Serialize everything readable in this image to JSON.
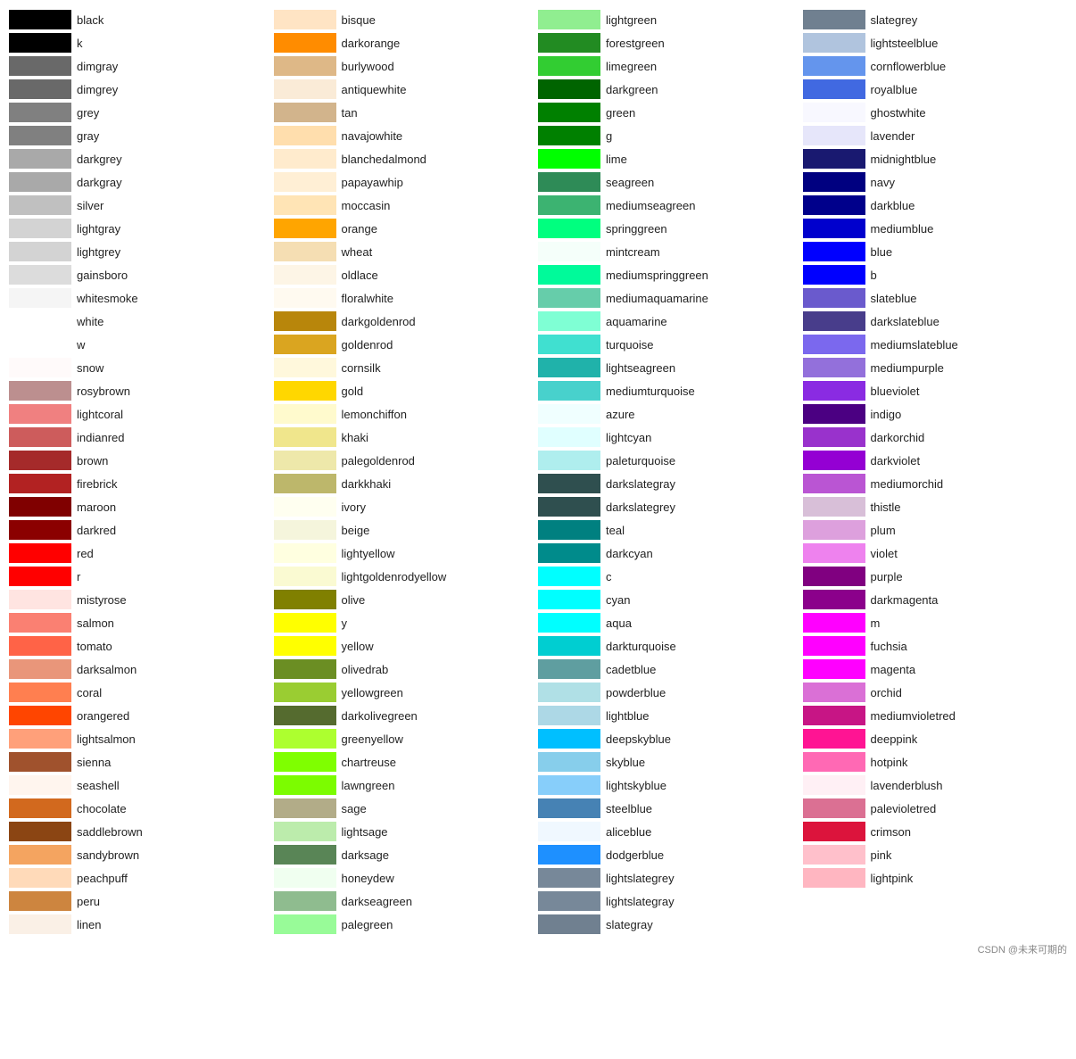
{
  "columns": [
    {
      "id": "col1",
      "items": [
        {
          "name": "black",
          "color": "#000000"
        },
        {
          "name": "k",
          "color": "#000000"
        },
        {
          "name": "dimgray",
          "color": "#696969"
        },
        {
          "name": "dimgrey",
          "color": "#696969"
        },
        {
          "name": "grey",
          "color": "#808080"
        },
        {
          "name": "gray",
          "color": "#808080"
        },
        {
          "name": "darkgrey",
          "color": "#a9a9a9"
        },
        {
          "name": "darkgray",
          "color": "#a9a9a9"
        },
        {
          "name": "silver",
          "color": "#c0c0c0"
        },
        {
          "name": "lightgray",
          "color": "#d3d3d3"
        },
        {
          "name": "lightgrey",
          "color": "#d3d3d3"
        },
        {
          "name": "gainsboro",
          "color": "#dcdcdc"
        },
        {
          "name": "whitesmoke",
          "color": "#f5f5f5"
        },
        {
          "name": "white",
          "color": "#ffffff"
        },
        {
          "name": "w",
          "color": "#ffffff"
        },
        {
          "name": "snow",
          "color": "#fffafa"
        },
        {
          "name": "rosybrown",
          "color": "#bc8f8f"
        },
        {
          "name": "lightcoral",
          "color": "#f08080"
        },
        {
          "name": "indianred",
          "color": "#cd5c5c"
        },
        {
          "name": "brown",
          "color": "#a52a2a"
        },
        {
          "name": "firebrick",
          "color": "#b22222"
        },
        {
          "name": "maroon",
          "color": "#800000"
        },
        {
          "name": "darkred",
          "color": "#8b0000"
        },
        {
          "name": "red",
          "color": "#ff0000"
        },
        {
          "name": "r",
          "color": "#ff0000"
        },
        {
          "name": "mistyrose",
          "color": "#ffe4e1"
        },
        {
          "name": "salmon",
          "color": "#fa8072"
        },
        {
          "name": "tomato",
          "color": "#ff6347"
        },
        {
          "name": "darksalmon",
          "color": "#e9967a"
        },
        {
          "name": "coral",
          "color": "#ff7f50"
        },
        {
          "name": "orangered",
          "color": "#ff4500"
        },
        {
          "name": "lightsalmon",
          "color": "#ffa07a"
        },
        {
          "name": "sienna",
          "color": "#a0522d"
        },
        {
          "name": "seashell",
          "color": "#fff5ee"
        },
        {
          "name": "chocolate",
          "color": "#d2691e"
        },
        {
          "name": "saddlebrown",
          "color": "#8b4513"
        },
        {
          "name": "sandybrown",
          "color": "#f4a460"
        },
        {
          "name": "peachpuff",
          "color": "#ffdab9"
        },
        {
          "name": "peru",
          "color": "#cd853f"
        },
        {
          "name": "linen",
          "color": "#faf0e6"
        }
      ]
    },
    {
      "id": "col2",
      "items": [
        {
          "name": "bisque",
          "color": "#ffe4c4"
        },
        {
          "name": "darkorange",
          "color": "#ff8c00"
        },
        {
          "name": "burlywood",
          "color": "#deb887"
        },
        {
          "name": "antiquewhite",
          "color": "#faebd7"
        },
        {
          "name": "tan",
          "color": "#d2b48c"
        },
        {
          "name": "navajowhite",
          "color": "#ffdead"
        },
        {
          "name": "blanchedalmond",
          "color": "#ffebcd"
        },
        {
          "name": "papayawhip",
          "color": "#ffefd5"
        },
        {
          "name": "moccasin",
          "color": "#ffe4b5"
        },
        {
          "name": "orange",
          "color": "#ffa500"
        },
        {
          "name": "wheat",
          "color": "#f5deb3"
        },
        {
          "name": "oldlace",
          "color": "#fdf5e6"
        },
        {
          "name": "floralwhite",
          "color": "#fffaf0"
        },
        {
          "name": "darkgoldenrod",
          "color": "#b8860b"
        },
        {
          "name": "goldenrod",
          "color": "#daa520"
        },
        {
          "name": "cornsilk",
          "color": "#fff8dc"
        },
        {
          "name": "gold",
          "color": "#ffd700"
        },
        {
          "name": "lemonchiffon",
          "color": "#fffacd"
        },
        {
          "name": "khaki",
          "color": "#f0e68c"
        },
        {
          "name": "palegoldenrod",
          "color": "#eee8aa"
        },
        {
          "name": "darkkhaki",
          "color": "#bdb76b"
        },
        {
          "name": "ivory",
          "color": "#fffff0"
        },
        {
          "name": "beige",
          "color": "#f5f5dc"
        },
        {
          "name": "lightyellow",
          "color": "#ffffe0"
        },
        {
          "name": "lightgoldenrodyellow",
          "color": "#fafad2"
        },
        {
          "name": "olive",
          "color": "#808000"
        },
        {
          "name": "y",
          "color": "#ffff00"
        },
        {
          "name": "yellow",
          "color": "#ffff00"
        },
        {
          "name": "olivedrab",
          "color": "#6b8e23"
        },
        {
          "name": "yellowgreen",
          "color": "#9acd32"
        },
        {
          "name": "darkolivegreen",
          "color": "#556b2f"
        },
        {
          "name": "greenyellow",
          "color": "#adff2f"
        },
        {
          "name": "chartreuse",
          "color": "#7fff00"
        },
        {
          "name": "lawngreen",
          "color": "#7cfc00"
        },
        {
          "name": "sage",
          "color": "#b2ac88"
        },
        {
          "name": "lightsage",
          "color": "#bcecac"
        },
        {
          "name": "darksage",
          "color": "#598556"
        },
        {
          "name": "honeydew",
          "color": "#f0fff0"
        },
        {
          "name": "darkseagreen",
          "color": "#8fbc8f"
        },
        {
          "name": "palegreen",
          "color": "#98fb98"
        }
      ]
    },
    {
      "id": "col3",
      "items": [
        {
          "name": "lightgreen",
          "color": "#90ee90"
        },
        {
          "name": "forestgreen",
          "color": "#228b22"
        },
        {
          "name": "limegreen",
          "color": "#32cd32"
        },
        {
          "name": "darkgreen",
          "color": "#006400"
        },
        {
          "name": "green",
          "color": "#008000"
        },
        {
          "name": "g",
          "color": "#008000"
        },
        {
          "name": "lime",
          "color": "#00ff00"
        },
        {
          "name": "seagreen",
          "color": "#2e8b57"
        },
        {
          "name": "mediumseagreen",
          "color": "#3cb371"
        },
        {
          "name": "springgreen",
          "color": "#00ff7f"
        },
        {
          "name": "mintcream",
          "color": "#f5fffa"
        },
        {
          "name": "mediumspringgreen",
          "color": "#00fa9a"
        },
        {
          "name": "mediumaquamarine",
          "color": "#66cdaa"
        },
        {
          "name": "aquamarine",
          "color": "#7fffd4"
        },
        {
          "name": "turquoise",
          "color": "#40e0d0"
        },
        {
          "name": "lightseagreen",
          "color": "#20b2aa"
        },
        {
          "name": "mediumturquoise",
          "color": "#48d1cc"
        },
        {
          "name": "azure",
          "color": "#f0ffff"
        },
        {
          "name": "lightcyan",
          "color": "#e0ffff"
        },
        {
          "name": "paleturquoise",
          "color": "#afeeee"
        },
        {
          "name": "darkslategray",
          "color": "#2f4f4f"
        },
        {
          "name": "darkslategrey",
          "color": "#2f4f4f"
        },
        {
          "name": "teal",
          "color": "#008080"
        },
        {
          "name": "darkcyan",
          "color": "#008b8b"
        },
        {
          "name": "c",
          "color": "#00ffff"
        },
        {
          "name": "cyan",
          "color": "#00ffff"
        },
        {
          "name": "aqua",
          "color": "#00ffff"
        },
        {
          "name": "darkturquoise",
          "color": "#00ced1"
        },
        {
          "name": "cadetblue",
          "color": "#5f9ea0"
        },
        {
          "name": "powderblue",
          "color": "#b0e0e6"
        },
        {
          "name": "lightblue",
          "color": "#add8e6"
        },
        {
          "name": "deepskyblue",
          "color": "#00bfff"
        },
        {
          "name": "skyblue",
          "color": "#87ceeb"
        },
        {
          "name": "lightskyblue",
          "color": "#87cefa"
        },
        {
          "name": "steelblue",
          "color": "#4682b4"
        },
        {
          "name": "aliceblue",
          "color": "#f0f8ff"
        },
        {
          "name": "dodgerblue",
          "color": "#1e90ff"
        },
        {
          "name": "lightslategrey",
          "color": "#778899"
        },
        {
          "name": "lightslategray",
          "color": "#778899"
        },
        {
          "name": "slategray",
          "color": "#708090"
        }
      ]
    },
    {
      "id": "col4",
      "items": [
        {
          "name": "slategrey",
          "color": "#708090"
        },
        {
          "name": "lightsteelblue",
          "color": "#b0c4de"
        },
        {
          "name": "cornflowerblue",
          "color": "#6495ed"
        },
        {
          "name": "royalblue",
          "color": "#4169e1"
        },
        {
          "name": "ghostwhite",
          "color": "#f8f8ff"
        },
        {
          "name": "lavender",
          "color": "#e6e6fa"
        },
        {
          "name": "midnightblue",
          "color": "#191970"
        },
        {
          "name": "navy",
          "color": "#000080"
        },
        {
          "name": "darkblue",
          "color": "#00008b"
        },
        {
          "name": "mediumblue",
          "color": "#0000cd"
        },
        {
          "name": "blue",
          "color": "#0000ff"
        },
        {
          "name": "b",
          "color": "#0000ff"
        },
        {
          "name": "slateblue",
          "color": "#6a5acd"
        },
        {
          "name": "darkslateblue",
          "color": "#483d8b"
        },
        {
          "name": "mediumslateblue",
          "color": "#7b68ee"
        },
        {
          "name": "mediumpurple",
          "color": "#9370db"
        },
        {
          "name": "blueviolet",
          "color": "#8a2be2"
        },
        {
          "name": "indigo",
          "color": "#4b0082"
        },
        {
          "name": "darkorchid",
          "color": "#9932cc"
        },
        {
          "name": "darkviolet",
          "color": "#9400d3"
        },
        {
          "name": "mediumorchid",
          "color": "#ba55d3"
        },
        {
          "name": "thistle",
          "color": "#d8bfd8"
        },
        {
          "name": "plum",
          "color": "#dda0dd"
        },
        {
          "name": "violet",
          "color": "#ee82ee"
        },
        {
          "name": "purple",
          "color": "#800080"
        },
        {
          "name": "darkmagenta",
          "color": "#8b008b"
        },
        {
          "name": "m",
          "color": "#ff00ff"
        },
        {
          "name": "fuchsia",
          "color": "#ff00ff"
        },
        {
          "name": "magenta",
          "color": "#ff00ff"
        },
        {
          "name": "orchid",
          "color": "#da70d6"
        },
        {
          "name": "mediumvioletred",
          "color": "#c71585"
        },
        {
          "name": "deeppink",
          "color": "#ff1493"
        },
        {
          "name": "hotpink",
          "color": "#ff69b4"
        },
        {
          "name": "lavenderblush",
          "color": "#fff0f5"
        },
        {
          "name": "palevioletred",
          "color": "#db7093"
        },
        {
          "name": "crimson",
          "color": "#dc143c"
        },
        {
          "name": "pink",
          "color": "#ffc0cb"
        },
        {
          "name": "lightpink",
          "color": "#ffb6c1"
        }
      ]
    }
  ],
  "footer": "CSDN @未来可期的"
}
